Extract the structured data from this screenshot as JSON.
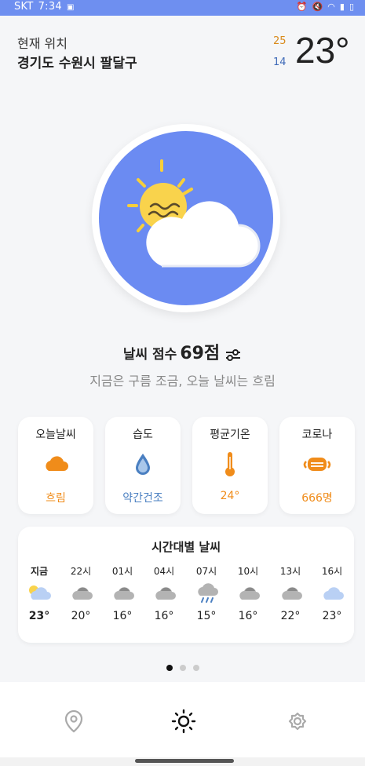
{
  "status_bar": {
    "carrier": "SKT",
    "time": "7:34"
  },
  "location": {
    "label": "현재 위치",
    "name": "경기도 수원시 팔달구"
  },
  "temperature": {
    "high": "25",
    "low": "14",
    "current": "23°"
  },
  "score": {
    "label": "날씨 점수",
    "value": "69점",
    "summary": "지금은 구름 조금, 오늘 날씨는 흐림"
  },
  "cards": [
    {
      "title": "오늘날씨",
      "value": "흐림",
      "icon": "cloud-icon",
      "color": "#f08c1a"
    },
    {
      "title": "습도",
      "value": "약간건조",
      "icon": "water-drop-icon",
      "color": "#4a7fc1"
    },
    {
      "title": "평균기온",
      "value": "24°",
      "icon": "thermometer-icon",
      "color": "#f08c1a"
    },
    {
      "title": "코로나",
      "value": "666명",
      "icon": "mask-icon",
      "color": "#f08c1a"
    }
  ],
  "hourly": {
    "title": "시간대별 날씨",
    "items": [
      {
        "time": "지금",
        "temp": "23°",
        "icon": "partly-cloudy-icon"
      },
      {
        "time": "22시",
        "temp": "20°",
        "icon": "cloudy-icon"
      },
      {
        "time": "01시",
        "temp": "16°",
        "icon": "cloudy-icon"
      },
      {
        "time": "04시",
        "temp": "16°",
        "icon": "cloudy-icon"
      },
      {
        "time": "07시",
        "temp": "15°",
        "icon": "rain-icon"
      },
      {
        "time": "10시",
        "temp": "16°",
        "icon": "cloudy-icon"
      },
      {
        "time": "13시",
        "temp": "22°",
        "icon": "cloudy-icon"
      },
      {
        "time": "16시",
        "temp": "23°",
        "icon": "light-cloud-icon"
      }
    ]
  },
  "pager": {
    "count": 3,
    "active": 0
  },
  "nav": [
    "location-icon",
    "sun-icon",
    "gear-icon"
  ],
  "colors": {
    "accent": "#6b8bf2",
    "orange": "#f08c1a",
    "blue": "#4a7fc1"
  }
}
